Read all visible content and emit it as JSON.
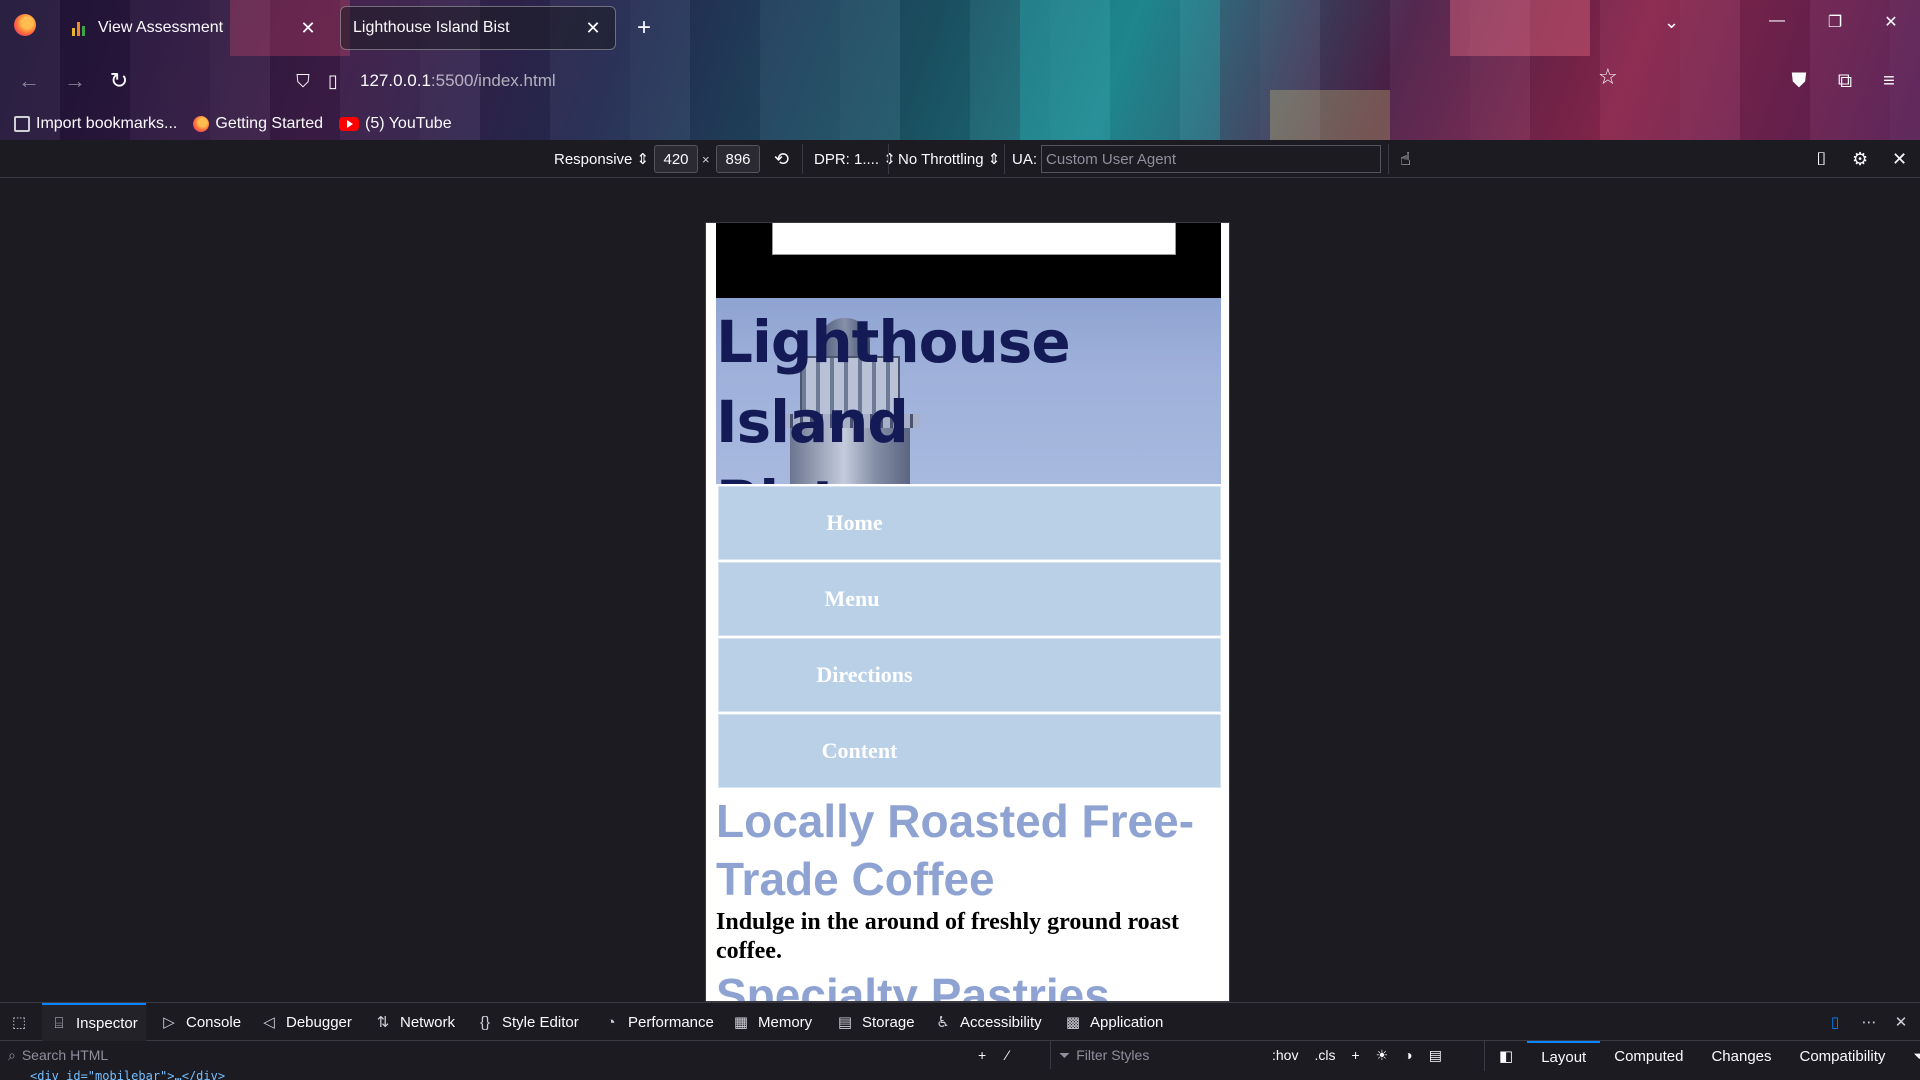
{
  "browser": {
    "tabs": [
      {
        "title": "View Assessment",
        "active": false
      },
      {
        "title": "Lighthouse Island Bist",
        "active": true
      }
    ],
    "url": {
      "host": "127.0.0.1",
      "path": ":5500/index.html"
    },
    "bookmarks": [
      {
        "label": "Import bookmarks...",
        "icon": "import-icon"
      },
      {
        "label": "Getting Started",
        "icon": "firefox-icon"
      },
      {
        "label": "(5) YouTube",
        "icon": "youtube-icon"
      }
    ]
  },
  "rdm": {
    "device": "Responsive",
    "width": "420",
    "times": "×",
    "height": "896",
    "dpr": "DPR: 1....",
    "throttling": "No Throttling",
    "ua_label": "UA:",
    "ua_placeholder": "Custom User Agent"
  },
  "site": {
    "title": "Lighthouse Island Bistro",
    "title_line1": "Lighthouse Island",
    "title_line2": "Bistro",
    "nav": [
      "Home",
      "Menu",
      "Directions",
      "Content"
    ],
    "heading1": "Locally Roasted Free-Trade Coffee",
    "heading1_line1": "Locally Roasted Free-",
    "heading1_line2": "Trade Coffee",
    "paragraph1": "Indulge in the around of freshly ground roast coffee.",
    "heading2": "Specialty Pastries"
  },
  "devtools": {
    "tabs": [
      "Inspector",
      "Console",
      "Debugger",
      "Network",
      "Style Editor",
      "Performance",
      "Memory",
      "Storage",
      "Accessibility",
      "Application"
    ],
    "active_tab": "Inspector",
    "search_placeholder": "Search HTML",
    "filter_placeholder": "Filter Styles",
    "hov": ":hov",
    "cls": ".cls",
    "side_tabs": [
      "Layout",
      "Computed",
      "Changes",
      "Compatibility"
    ],
    "active_side_tab": "Layout",
    "markup_line": "<div id=\"mobilebar\">…</div>"
  },
  "colors": {
    "accent": "#0a84ff",
    "nav_bg": "#bad0e7",
    "heading_color": "#8fa3d2",
    "title_color": "#141a55"
  }
}
